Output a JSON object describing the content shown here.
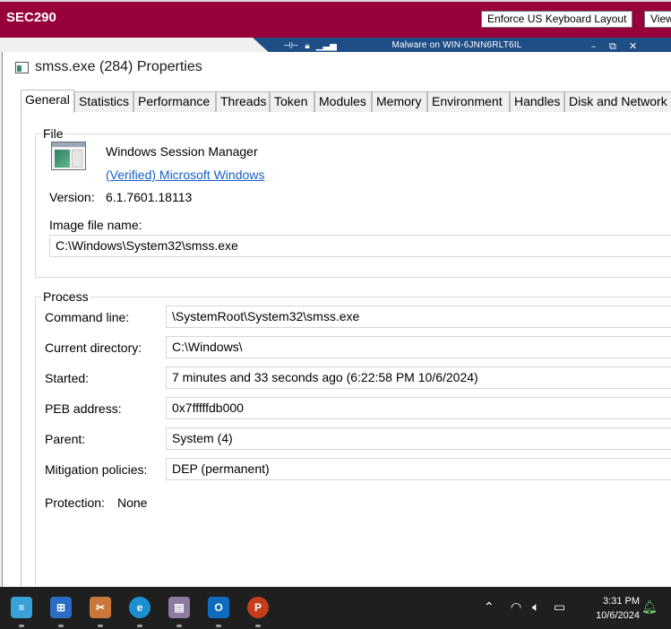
{
  "banner": {
    "title": "SEC290",
    "keyboard_button": "Enforce US Keyboard Layout",
    "view_button": "View"
  },
  "connection_bar": {
    "title": "Malware on WIN-6JNN6RLT6IL",
    "color": "#1f4e86"
  },
  "window": {
    "title": "smss.exe (284) Properties"
  },
  "tabs": [
    {
      "label": "General",
      "active": true
    },
    {
      "label": "Statistics"
    },
    {
      "label": "Performance"
    },
    {
      "label": "Threads"
    },
    {
      "label": "Token"
    },
    {
      "label": "Modules"
    },
    {
      "label": "Memory"
    },
    {
      "label": "Environment"
    },
    {
      "label": "Handles"
    },
    {
      "label": "Disk and Network"
    }
  ],
  "file": {
    "group_label": "File",
    "description": "Windows Session Manager",
    "verified": "(Verified) Microsoft Windows",
    "version_label": "Version:",
    "version": "6.1.7601.18113",
    "image_label": "Image file name:",
    "image_path": "C:\\Windows\\System32\\smss.exe"
  },
  "process": {
    "group_label": "Process",
    "command_line_label": "Command line:",
    "command_line": "\\SystemRoot\\System32\\smss.exe",
    "current_dir_label": "Current directory:",
    "current_dir": "C:\\Windows\\",
    "started_label": "Started:",
    "started": "7 minutes and 33 seconds ago (6:22:58 PM 10/6/2024)",
    "peb_label": "PEB address:",
    "peb": "0x7fffffdb000",
    "parent_label": "Parent:",
    "parent": "System (4)",
    "mitigation_label": "Mitigation policies:",
    "mitigation": "DEP (permanent)",
    "protection_label": "Protection:",
    "protection": "None"
  },
  "taskbar": {
    "time": "3:31 PM",
    "date": "10/6/2024",
    "icons": [
      "notepad-icon",
      "store-icon",
      "snipping-tool-icon",
      "edge-icon",
      "file-icon",
      "outlook-icon",
      "powerpoint-icon"
    ]
  }
}
